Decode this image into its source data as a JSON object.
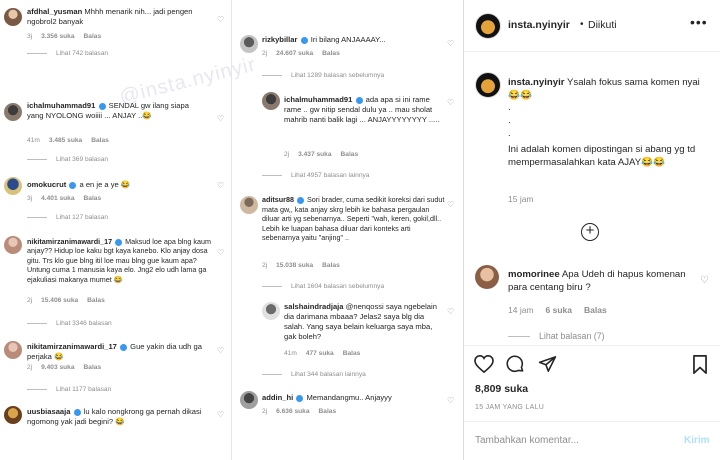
{
  "post_image": {
    "watermark": "@insta.nyinyir",
    "left_column": [
      {
        "user": "afdhal_yusman",
        "text": "Mhhh menarik nih... jadi pengen ngobrol2 banyak",
        "age": "3j",
        "likes": "3.356 suka",
        "reply": "Balas",
        "more": "Lihat 742 balasan"
      },
      {
        "user": "ichalmuhammad91",
        "text": "SENDAL gw ilang siapa yang NYOLONG woiiii ... ANJAY ..😂",
        "age": "41m",
        "likes": "3.485 suka",
        "reply": "Balas",
        "more": "Lihat 369 balasan"
      },
      {
        "user": "omokucrut",
        "text": "a en je a ye 😂",
        "age": "3j",
        "likes": "4.401 suka",
        "reply": "Balas",
        "more": "Lihat 127 balasan"
      },
      {
        "user": "nikitamirzanimawardi_17",
        "text": "Maksud loe apa blng kaum anjay?? Hidup loe kaku bgt kaya kanebo. Klo anjay dosa gitu. Trs klo gue blng itil loe mau blng gue kaum apa? Untung cuma 1 manusia kaya elo. Jng2 elo udh lama ga ejakuliasi makanya mumet 😂",
        "age": "2j",
        "likes": "15.406 suka",
        "reply": "Balas",
        "more": "Lihat 3346 balasan"
      },
      {
        "user": "nikitamirzanimawardi_17",
        "text": "Gue yakin dia udh ga perjaka 😂",
        "age": "2j",
        "likes": "9.403 suka",
        "reply": "Balas",
        "more": "Lihat 1177 balasan"
      },
      {
        "user": "uusbiasaaja",
        "text": "lu kalo nongkrong ga pernah dikasi ngomong yak jadi begini? 😂",
        "age": "",
        "likes": "",
        "reply": "",
        "more": ""
      }
    ],
    "right_column": [
      {
        "user": "rizkybillar",
        "text": "Iri bilang ANJAAAAY...",
        "age": "2j",
        "likes": "24.607 suka",
        "reply": "Balas",
        "more": "Lihat 1289 balasan sebelumnya"
      },
      {
        "user": "ichalmuhammad91",
        "text": "ada apa si ini rame rame .. gw nitip sendal dulu ya .. mau sholat mahrib nanti balik lagi ... ANJAYYYYYYYY .....",
        "age": "2j",
        "likes": "3.437 suka",
        "reply": "Balas",
        "more": "Lihat 4957 balasan lainnya"
      },
      {
        "user": "aditsur88",
        "text": "Sori brader, cuma sedikit koreksi dari sudut mata gw,, kata anjay skrg lebih ke bahasa pergaulan diluar arti yg sebenarnya.. Seperti \"wah, keren, gokil,dll.. Lebih ke luapan bahasa diluar dari konteks arti sebenarnya yaitu \"anjing\" ..",
        "age": "2j",
        "likes": "15.038 suka",
        "reply": "Balas",
        "more": "Lihat 1604 balasan sebelumnya"
      },
      {
        "user": "salshaindradjaja",
        "text": "@nenqossi saya ngebelain dia darimana mbaaa? Jelas2 saya blg dia salah. Yang saya belain keluarga saya mba, gak boleh?",
        "age": "41m",
        "likes": "477 suka",
        "reply": "Balas",
        "more": "Lihat 344 balasan lainnya"
      },
      {
        "user": "addin_hi",
        "text": "Memandangmu.. Anjayyy",
        "age": "2j",
        "likes": "6.636 suka",
        "reply": "Balas",
        "more": ""
      }
    ]
  },
  "panel": {
    "header": {
      "username": "insta.nyinyir",
      "separator": "•",
      "follow": "Diikuti",
      "menu": "•••"
    },
    "caption": {
      "username": "insta.nyinyir",
      "line1": "Ysalah fokus sama komen nyai😂😂",
      "dots": [
        ".",
        ".",
        "."
      ],
      "line2": "Ini adalah komen dipostingan si abang yg td mempermasalahkan kata AJAY😂😂",
      "time": "15 jam"
    },
    "comment": {
      "username": "momorinee",
      "text": "Apa Udeh di hapus komenan para centang biru ?",
      "time": "14 jam",
      "likes": "6 suka",
      "reply": "Balas",
      "replies": "Lihat balasan (7)"
    },
    "likes": "8,809 suka",
    "posted": "15 JAM YANG LALU",
    "add_comment": {
      "placeholder": "Tambahkan komentar...",
      "send": "Kirim"
    }
  }
}
